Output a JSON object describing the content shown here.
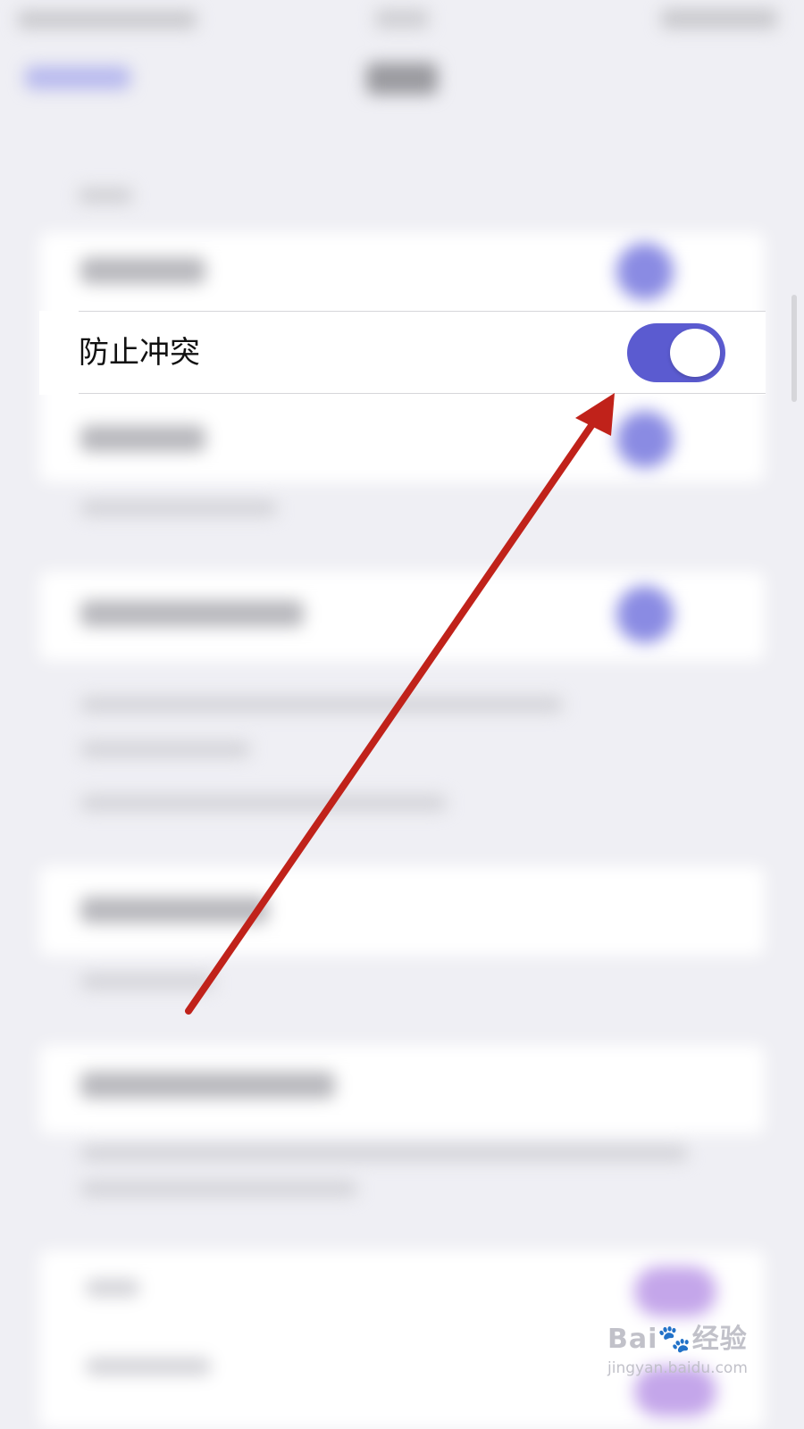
{
  "setting_row": {
    "label": "防止冲突",
    "toggle_on": true,
    "toggle_color": "#5b5bd0"
  },
  "annotation": {
    "arrow_color": "#c0221a"
  },
  "watermark": {
    "brand_left": "Bai",
    "brand_paw": "🐾",
    "brand_right": "经验",
    "url": "jingyan.baidu.com"
  }
}
